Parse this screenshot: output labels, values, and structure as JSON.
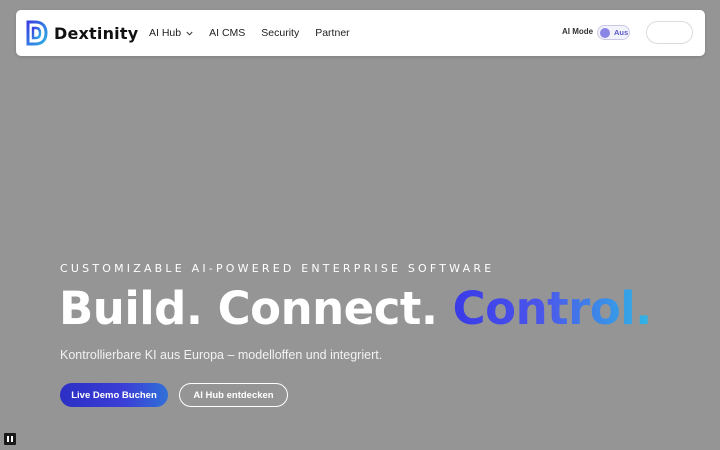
{
  "navbar": {
    "brand": "Dextinity",
    "links": [
      {
        "label": "AI Hub",
        "has_dropdown": true
      },
      {
        "label": "AI CMS",
        "has_dropdown": false
      },
      {
        "label": "Security",
        "has_dropdown": false
      },
      {
        "label": "Partner",
        "has_dropdown": false
      }
    ],
    "ai_mode_label": "AI Mode",
    "ai_mode_state": "Aus",
    "cta_label": ""
  },
  "hero": {
    "eyebrow": "CUSTOMIZABLE AI-POWERED ENTERPRISE SOFTWARE",
    "headline_part1": "Build. Connect. ",
    "headline_part2": "Control.",
    "subline": "Kontrollierbare KI aus Europa – modelloffen und integriert.",
    "primary_button": "Live Demo Buchen",
    "secondary_button": "AI Hub entdecken"
  },
  "media_controls": {
    "pause_icon": "pause-icon"
  },
  "colors": {
    "background": "#959595",
    "accent_start": "#3a3ae8",
    "accent_end": "#2fb7e6",
    "toggle_knob": "#8a86e6"
  }
}
